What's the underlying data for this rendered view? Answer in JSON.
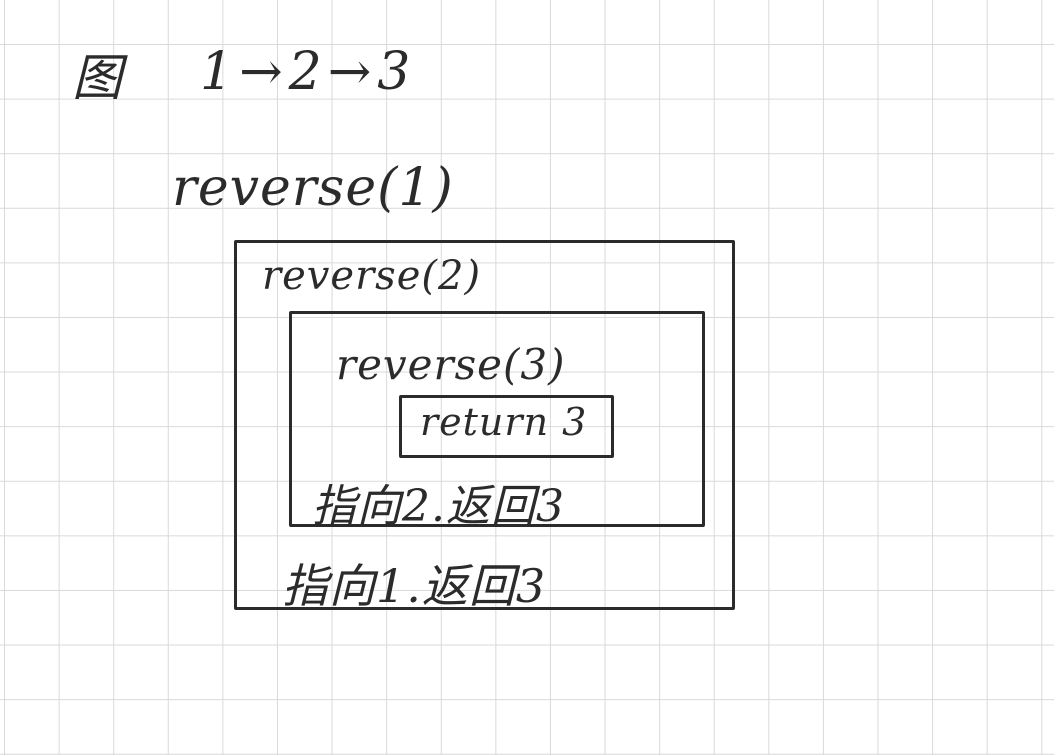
{
  "note": {
    "title_char": "图",
    "sequence": "1→2→3",
    "call_outer": "reverse(1)",
    "call_middle": "reverse(2)",
    "call_inner": "reverse(3)",
    "return_inner": "return 3",
    "step_middle": "指向2.返回3",
    "step_outer": "指向1.返回3"
  },
  "colors": {
    "ink": "#2b2b2b",
    "grid": "#d9d9d9",
    "paper": "#ffffff"
  }
}
